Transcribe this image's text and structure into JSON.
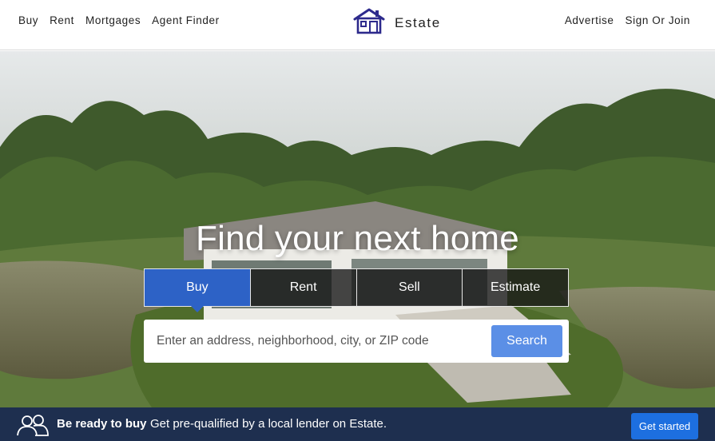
{
  "nav": {
    "left_links": [
      "Buy",
      "Rent",
      "Mortgages",
      "Agent Finder"
    ],
    "brand": "Estate",
    "brand_icon": "house-icon",
    "brand_color": "#2d2a8c",
    "right_links": [
      "Advertise",
      "Sign Or Join"
    ]
  },
  "hero": {
    "title": "Find your next home",
    "tabs": [
      {
        "label": "Buy",
        "active": true
      },
      {
        "label": "Rent",
        "active": false
      },
      {
        "label": "Sell",
        "active": false
      },
      {
        "label": "Estimate",
        "active": false
      }
    ],
    "search": {
      "placeholder": "Enter an address, neighborhood, city, or ZIP code",
      "button_label": "Search"
    },
    "accent_color": "#2d62c6"
  },
  "banner": {
    "icon": "users-icon",
    "strong_text": "Be ready to buy",
    "text": "Get pre-qualified by a local lender on Estate.",
    "button_label": "Get started",
    "button_color": "#1d6fe0"
  }
}
